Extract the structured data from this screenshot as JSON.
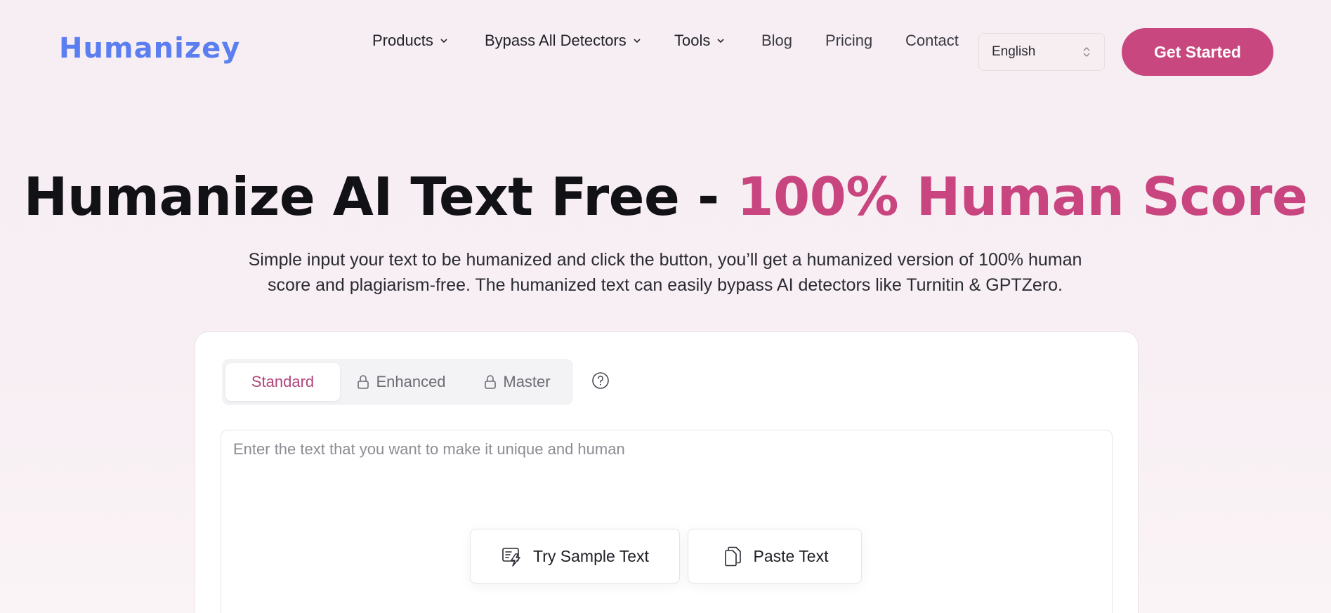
{
  "header": {
    "logo": "Humanizey",
    "nav": {
      "products": "Products",
      "bypass": "Bypass All Detectors",
      "tools": "Tools",
      "blog": "Blog",
      "pricing": "Pricing",
      "contact": "Contact"
    },
    "language": "English",
    "cta": "Get Started"
  },
  "hero": {
    "title_main": "Humanize AI Text Free - ",
    "title_accent": "100% Human Score",
    "subtitle_line1": "Simple input your text to be humanized and click the button, you’ll get a humanized version of 100% human",
    "subtitle_line2": "score and plagiarism-free. The humanized text can easily bypass AI detectors like Turnitin & GPTZero."
  },
  "tool": {
    "tabs": {
      "standard": "Standard",
      "enhanced": "Enhanced",
      "master": "Master"
    },
    "input_placeholder": "Enter the text that you want to make it unique and human",
    "try_sample": "Try Sample Text",
    "paste_text": "Paste Text"
  },
  "colors": {
    "brand_blue": "#5b7ef0",
    "accent_pink": "#c9457f",
    "background": "#f6eef2"
  },
  "icons": [
    "chevron-down-icon",
    "updown-chevron-icon",
    "lock-icon",
    "help-circle-icon",
    "sample-text-icon",
    "copy-icon"
  ]
}
